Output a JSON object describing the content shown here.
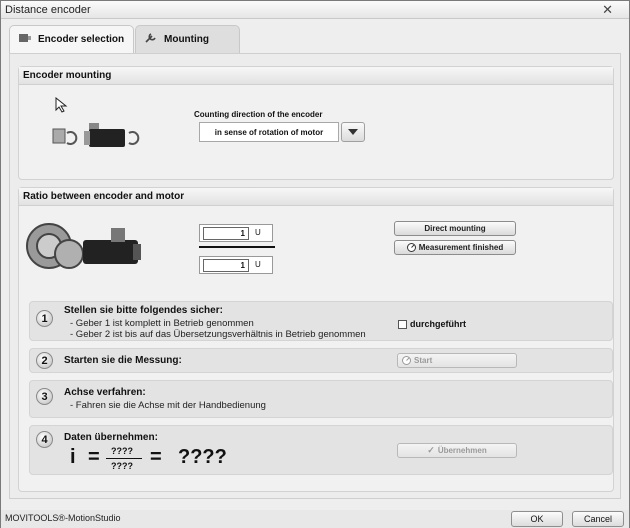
{
  "window": {
    "title": "Distance encoder",
    "close_glyph": "✕"
  },
  "tabs": [
    {
      "label": "Encoder selection",
      "icon": "encoder-icon"
    },
    {
      "label": "Mounting",
      "icon": "wrench-icon"
    }
  ],
  "encoder_mounting": {
    "header": "Encoder mounting",
    "counting_label": "Counting direction of the encoder",
    "counting_value": "in sense of rotation of motor"
  },
  "ratio": {
    "header": "Ratio between encoder and motor",
    "numerator": "1",
    "denominator": "1",
    "unit": "U",
    "direct_mounting_label": "Direct mounting",
    "measurement_finished_label": "Measurement finished"
  },
  "steps": {
    "s1": {
      "num": "1",
      "title": "Stellen sie bitte folgendes sicher:",
      "line1": "- Geber 1 ist komplett in Betrieb genommen",
      "line2": "- Geber 2 ist bis auf das Übersetzungsverhältnis in Betrieb genommen",
      "checkbox_label": "durchgeführt"
    },
    "s2": {
      "num": "2",
      "title": "Starten sie die Messung:",
      "button": "Start"
    },
    "s3": {
      "num": "3",
      "title": "Achse verfahren:",
      "line1": "- Fahren sie die Achse mit der Handbedienung"
    },
    "s4": {
      "num": "4",
      "title": "Daten übernehmen:",
      "i": "i",
      "eq": "=",
      "num_q": "????",
      "den_q": "????",
      "result": "????",
      "button": "Übernehmen"
    }
  },
  "footer": {
    "brand": "MOVITOOLS®-MotionStudio",
    "ok": "OK",
    "cancel": "Cancel"
  }
}
